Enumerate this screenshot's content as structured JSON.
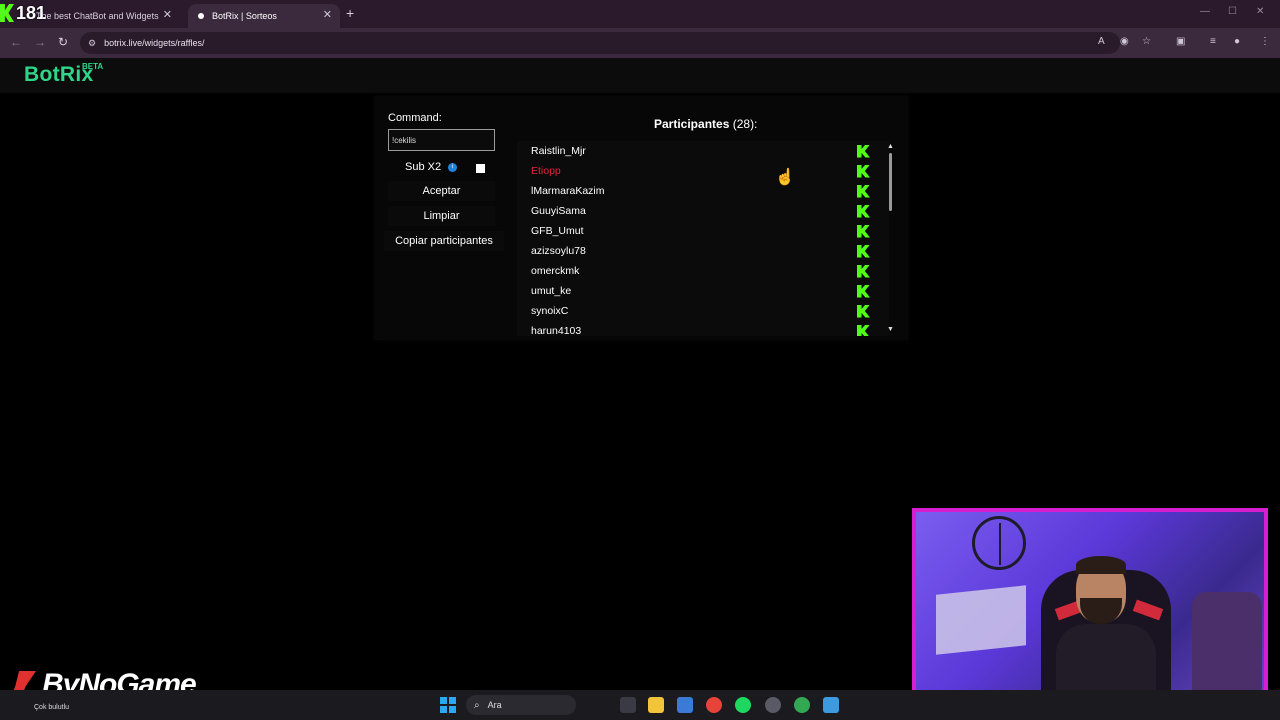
{
  "overlay": {
    "number": "181"
  },
  "browser": {
    "tabs": [
      {
        "title": "The best ChatBot and Widgets",
        "active": false
      },
      {
        "title": "BotRix | Sorteos",
        "active": true
      }
    ],
    "url": "botrix.live/widgets/raffles/"
  },
  "site": {
    "brand": "BotRix",
    "badge": "BETA"
  },
  "raffle": {
    "command_label": "Command:",
    "command_value": "!cekilis",
    "sub_x2_label": "Sub X2",
    "sub_x2_checked": false,
    "buttons": {
      "accept": "Aceptar",
      "clear": "Limpiar",
      "copy": "Copiar participantes"
    },
    "participants_title": "Participantes",
    "participants_count": "(28):",
    "participants": [
      {
        "name": "Raistlin_Mjr",
        "highlight": false
      },
      {
        "name": "Etiopp",
        "highlight": true
      },
      {
        "name": "lMarmaraKazim",
        "highlight": false
      },
      {
        "name": "GuuyiSama",
        "highlight": false
      },
      {
        "name": "GFB_Umut",
        "highlight": false
      },
      {
        "name": "azizsoylu78",
        "highlight": false
      },
      {
        "name": "omerckmk",
        "highlight": false
      },
      {
        "name": "umut_ke",
        "highlight": false
      },
      {
        "name": "synoixC",
        "highlight": false
      },
      {
        "name": "harun4103",
        "highlight": false
      }
    ],
    "platform_icon": "kick-icon",
    "colors": {
      "brand": "#2fd68a",
      "kick": "#53fc18",
      "highlight": "#e8213b"
    }
  },
  "watermark": {
    "logo": "ByNoGame",
    "subtext": "Çok bulutlu"
  },
  "taskbar": {
    "search_placeholder": "Ara"
  }
}
